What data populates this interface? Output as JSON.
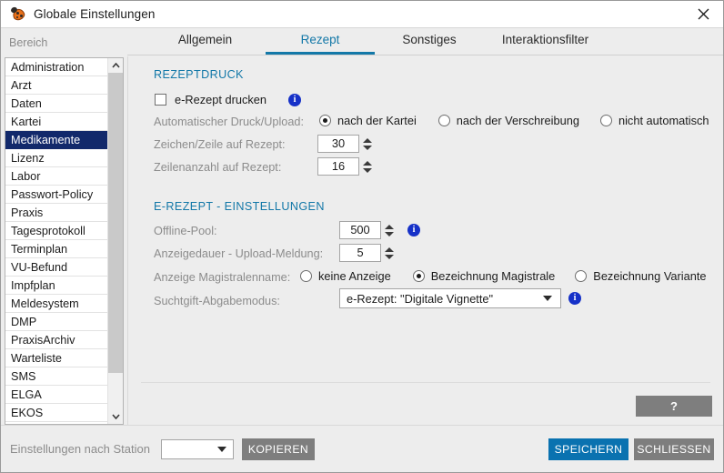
{
  "window": {
    "title": "Globale Einstellungen",
    "icon": "ladybug-icon",
    "close_label": "×"
  },
  "sidebar": {
    "header": "Bereich",
    "selected": "Medikamente",
    "items": [
      {
        "label": "Administration"
      },
      {
        "label": "Arzt"
      },
      {
        "label": "Daten"
      },
      {
        "label": "Kartei"
      },
      {
        "label": "Medikamente"
      },
      {
        "label": "Lizenz"
      },
      {
        "label": "Labor"
      },
      {
        "label": "Passwort-Policy"
      },
      {
        "label": "Praxis"
      },
      {
        "label": "Tagesprotokoll"
      },
      {
        "label": "Terminplan"
      },
      {
        "label": "VU-Befund"
      },
      {
        "label": "Impfplan"
      },
      {
        "label": "Meldesystem"
      },
      {
        "label": "DMP"
      },
      {
        "label": "PraxisArchiv"
      },
      {
        "label": "Warteliste"
      },
      {
        "label": "SMS"
      },
      {
        "label": "ELGA"
      },
      {
        "label": "EKOS"
      }
    ]
  },
  "tabs": [
    {
      "label": "Allgemein",
      "active": false
    },
    {
      "label": "Rezept",
      "active": true
    },
    {
      "label": "Sonstiges",
      "active": false
    },
    {
      "label": "Interaktionsfilter",
      "active": false
    }
  ],
  "rezeptdruck": {
    "section_title": "REZEPTDRUCK",
    "erezept_drucken": {
      "label": "e-Rezept drucken",
      "checked": false,
      "info": "i"
    },
    "auto_druck": {
      "label": "Automatischer Druck/Upload:",
      "options": [
        {
          "label": "nach der Kartei",
          "checked": true
        },
        {
          "label": "nach der Verschreibung",
          "checked": false
        },
        {
          "label": "nicht automatisch",
          "checked": false
        }
      ]
    },
    "zeichen_zeile": {
      "label": "Zeichen/Zeile auf Rezept:",
      "value": "30"
    },
    "zeilenanzahl": {
      "label": "Zeilenanzahl auf Rezept:",
      "value": "16"
    }
  },
  "erezept": {
    "section_title": "E-REZEPT - EINSTELLUNGEN",
    "offline_pool": {
      "label": "Offline-Pool:",
      "value": "500",
      "info": "i"
    },
    "anzeigedauer": {
      "label": "Anzeigedauer - Upload-Meldung:",
      "value": "5"
    },
    "magistralenname": {
      "label": "Anzeige Magistralenname:",
      "options": [
        {
          "label": "keine Anzeige",
          "checked": false
        },
        {
          "label": "Bezeichnung Magistrale",
          "checked": true
        },
        {
          "label": "Bezeichnung Variante",
          "checked": false
        }
      ]
    },
    "suchtgift": {
      "label": "Suchtgift-Abgabemodus:",
      "value": "e-Rezept: \"Digitale Vignette\"",
      "info": "i"
    }
  },
  "help_button": "?",
  "footer": {
    "station_label": "Einstellungen nach Station",
    "station_value": "",
    "kopieren": "KOPIEREN",
    "speichern": "SPEICHERN",
    "schliessen": "SCHLIESSEN"
  },
  "colors": {
    "accent_blue": "#1378a8",
    "selected_navy": "#12296b",
    "button_blue": "#0a72b0",
    "button_grey": "#7e7e7e",
    "info_blue": "#1631c8",
    "bg": "#ededed"
  }
}
